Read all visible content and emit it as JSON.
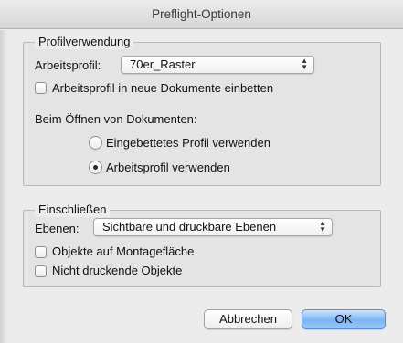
{
  "window": {
    "title": "Preflight-Optionen"
  },
  "profile_group": {
    "title": "Profilverwendung",
    "work_profile_label": "Arbeitsprofil:",
    "work_profile_value": "70er_Raster",
    "embed_checkbox_label": "Arbeitsprofil in neue Dokumente einbetten",
    "embed_checked": false,
    "opening_label": "Beim Öffnen von Dokumenten:",
    "radio_embedded_label": "Eingebettetes Profil verwenden",
    "radio_work_label": "Arbeitsprofil verwenden",
    "selected_option": "Arbeitsprofil verwenden"
  },
  "include_group": {
    "title": "Einschließen",
    "layers_label": "Ebenen:",
    "layers_value": "Sichtbare und druckbare Ebenen",
    "pasteboard_label": "Objekte auf Montagefläche",
    "pasteboard_checked": false,
    "nonprinting_label": "Nicht druckende Objekte",
    "nonprinting_checked": false
  },
  "buttons": {
    "cancel": "Abbrechen",
    "ok": "OK"
  },
  "icons": {
    "popup_arrows": "up-down-arrows-icon"
  },
  "colors": {
    "default_button": "#7db4f5"
  }
}
